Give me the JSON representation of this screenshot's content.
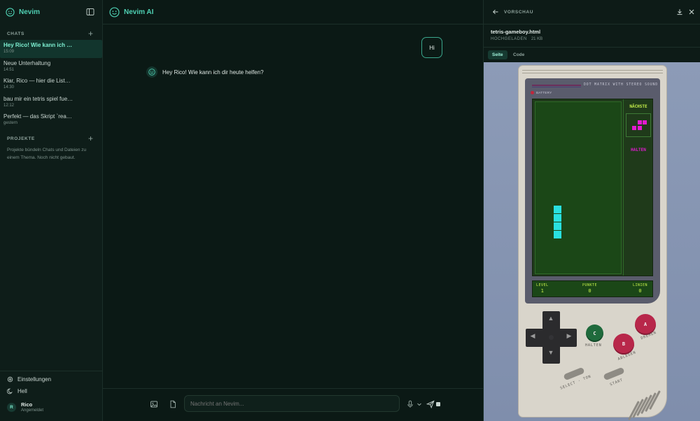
{
  "sidebar": {
    "brand": "Nevim",
    "chats_heading": "CHATS",
    "chats": [
      {
        "title": "Hey Rico! Wie kann ich …",
        "time": "15:09"
      },
      {
        "title": "Neue Unterhaltung",
        "time": "14:51"
      },
      {
        "title": "Klar, Rico — hier die List…",
        "time": "14:30"
      },
      {
        "title": "bau mir ein tetris spiel fue…",
        "time": "12:12"
      },
      {
        "title": "Perfekt — das Skript `rea…",
        "time": "gestern"
      }
    ],
    "projects_heading": "PROJEKTE",
    "projects_desc": "Projekte bündeln Chats und Dateien zu einem Thema. Noch nicht gebaut.",
    "settings_label": "Einstellungen",
    "theme_label": "Hell",
    "user": {
      "initial": "R",
      "name": "Rico",
      "status": "Angemeldet"
    }
  },
  "main": {
    "title": "Nevim AI",
    "user_message": "Hi",
    "bot_message": "Hey Rico! Wie kann ich dir heute helfen?",
    "composer_placeholder": "Nachricht an Nevim..."
  },
  "preview": {
    "label": "VORSCHAU",
    "file_name": "tetris-gameboy.html",
    "file_tag": "HOCHGELADEN",
    "file_size": "21 KB",
    "tabs": [
      {
        "label": "Seite",
        "active": true
      },
      {
        "label": "Code",
        "active": false
      }
    ]
  },
  "gameboy": {
    "stereo_text": "DOT MATRIX WITH STEREO SOUND",
    "battery_text": "BATTERY",
    "next_label": "NÄCHSTE",
    "hold_label": "HALTEN",
    "stats": [
      {
        "label": "LEVEL",
        "value": "1"
      },
      {
        "label": "PUNKTE",
        "value": "0"
      },
      {
        "label": "LINIEN",
        "value": "0"
      }
    ],
    "btn_c": "C",
    "btn_b": "B",
    "btn_a": "A",
    "label_halten": "HALTEN",
    "label_ablegen": "ABLEGEN",
    "label_drehen": "DREHEN",
    "label_select": "SELECT · TON",
    "label_start": "START"
  },
  "colors": {
    "accent": "#4fd1b4",
    "active_bg": "#12352d",
    "piece_cyan": "#29e0e0",
    "piece_magenta": "#e21ad0",
    "lcd_green": "#1b4717"
  }
}
